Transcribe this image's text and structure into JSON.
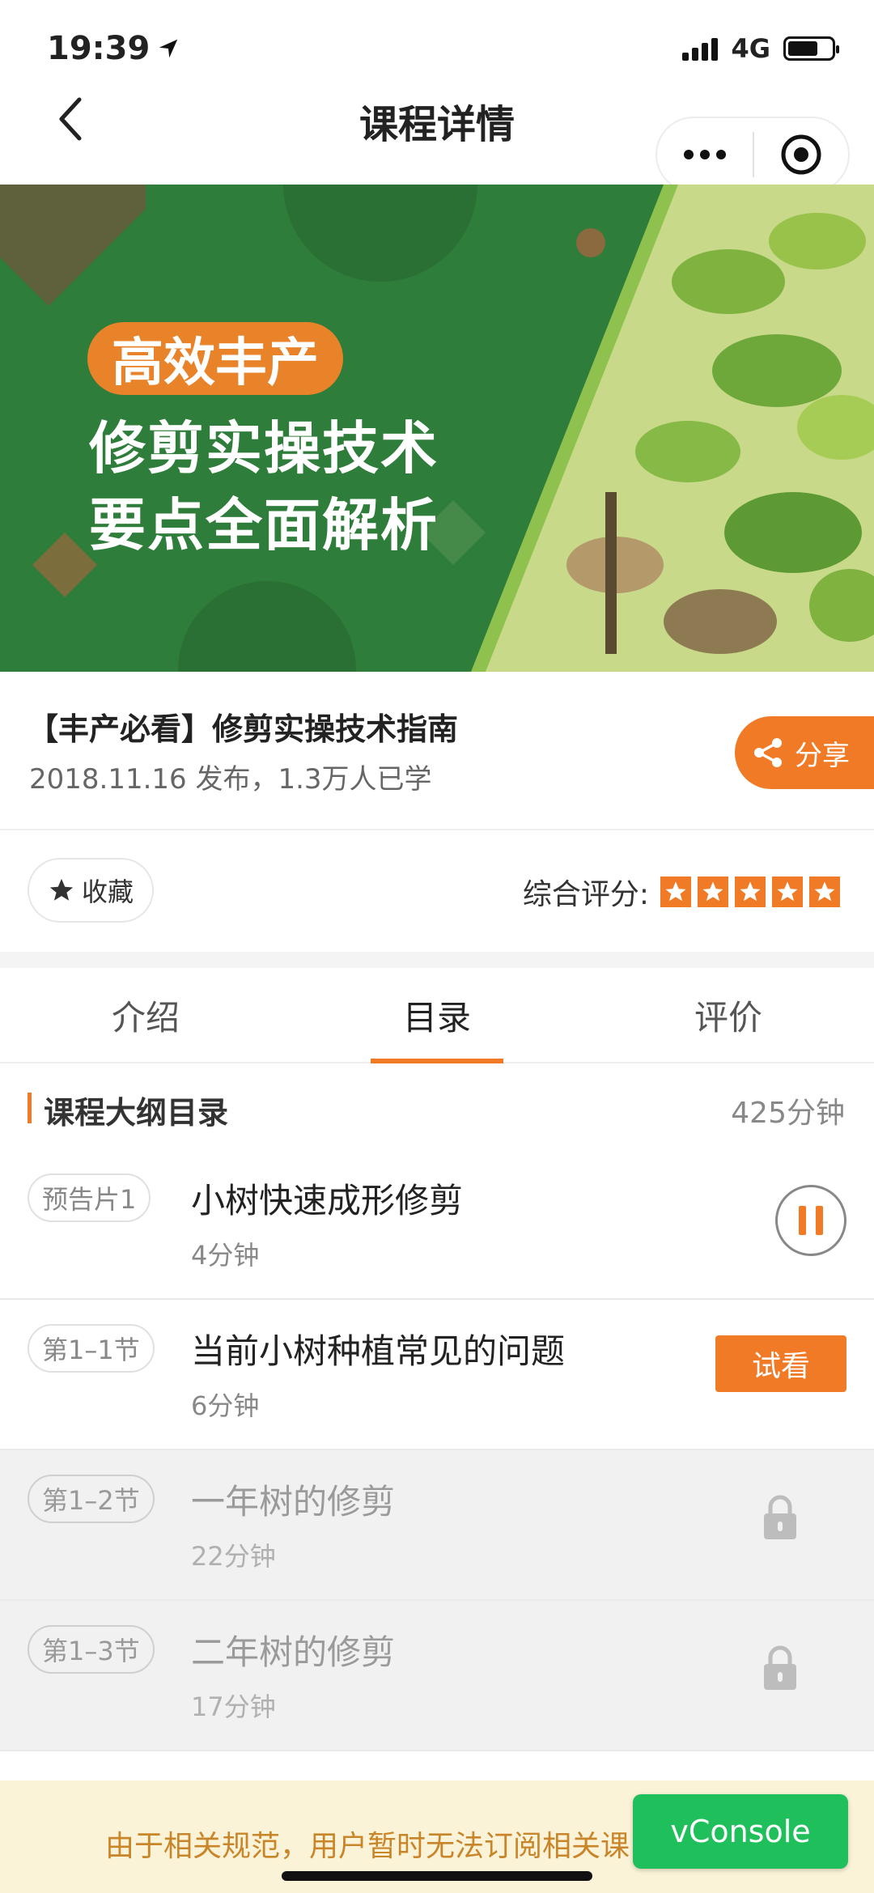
{
  "status_bar": {
    "time": "19:39",
    "network": "4G"
  },
  "nav": {
    "title": "课程详情"
  },
  "banner": {
    "tag": "高效丰产",
    "line1": "修剪实操技术",
    "line2": "要点全面解析"
  },
  "course": {
    "title": "【丰产必看】修剪实操技术指南",
    "meta": "2018.11.16 发布，1.3万人已学",
    "share_label": "分享"
  },
  "actions": {
    "collect_label": "收藏",
    "rating_label": "综合评分:",
    "rating_stars": 5
  },
  "tabs": [
    {
      "label": "介绍",
      "active": false
    },
    {
      "label": "目录",
      "active": true
    },
    {
      "label": "评价",
      "active": false
    }
  ],
  "outline": {
    "title": "课程大纲目录",
    "total": "425分钟"
  },
  "lessons": [
    {
      "badge": "预告片1",
      "title": "小树快速成形修剪",
      "duration": "4分钟",
      "state": "playing"
    },
    {
      "badge": "第1–1节",
      "title": "当前小树种植常见的问题",
      "duration": "6分钟",
      "state": "trial",
      "action_label": "试看"
    },
    {
      "badge": "第1–2节",
      "title": "一年树的修剪",
      "duration": "22分钟",
      "state": "locked"
    },
    {
      "badge": "第1–3节",
      "title": "二年树的修剪",
      "duration": "17分钟",
      "state": "locked"
    }
  ],
  "notice": {
    "text": "由于相关规范，用户暂时无法订阅相关课",
    "vconsole_label": "vConsole"
  },
  "colors": {
    "accent": "#f07a26",
    "banner_green": "#2f7d3a",
    "notice_bg": "#fbf3d7",
    "vconsole_green": "#1fbf5b"
  }
}
